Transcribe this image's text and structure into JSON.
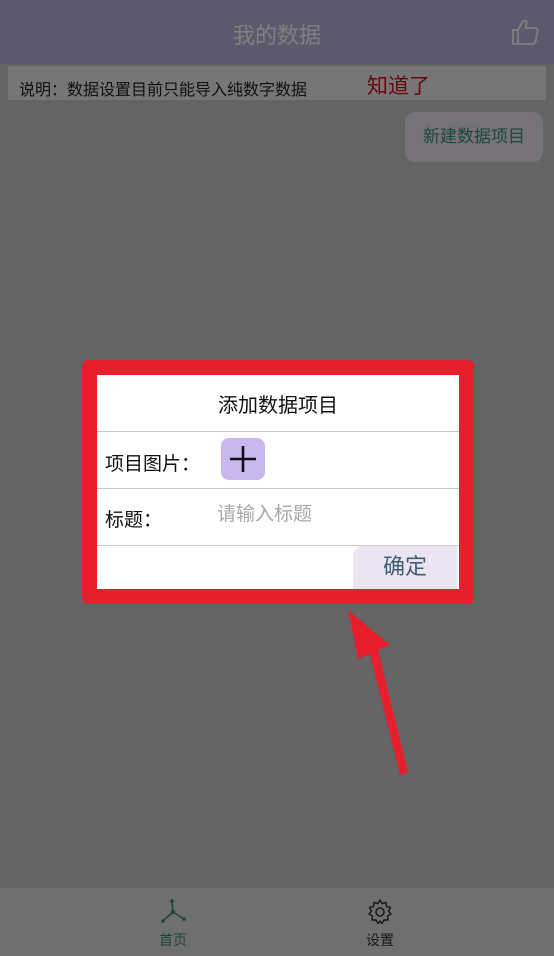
{
  "navbar": {
    "title": "我的数据",
    "action_icon": "thumbs-up-icon"
  },
  "notice": {
    "text": "说明：数据设置目前只能导入纯数字数据",
    "dismiss_label": "知道了"
  },
  "toolbar": {
    "new_item_label": "新建数据项目"
  },
  "dialog": {
    "title": "添加数据项目",
    "image_label": "项目图片：",
    "add_image_icon": "plus-icon",
    "title_label": "标题：",
    "title_placeholder": "请输入标题",
    "title_value": "",
    "confirm_label": "确定"
  },
  "tabbar": {
    "items": [
      {
        "label": "首页",
        "icon": "home-nodes-icon",
        "active": true
      },
      {
        "label": "设置",
        "icon": "gear-icon",
        "active": false
      }
    ]
  },
  "colors": {
    "nav_bg": "#b9b3d8",
    "accent_teal": "#3c8d80",
    "notice_red": "#d40f1c",
    "highlight_red": "#e71e2c",
    "add_button_purple": "#c8b8ee",
    "button_bg": "#ebe4f1"
  }
}
